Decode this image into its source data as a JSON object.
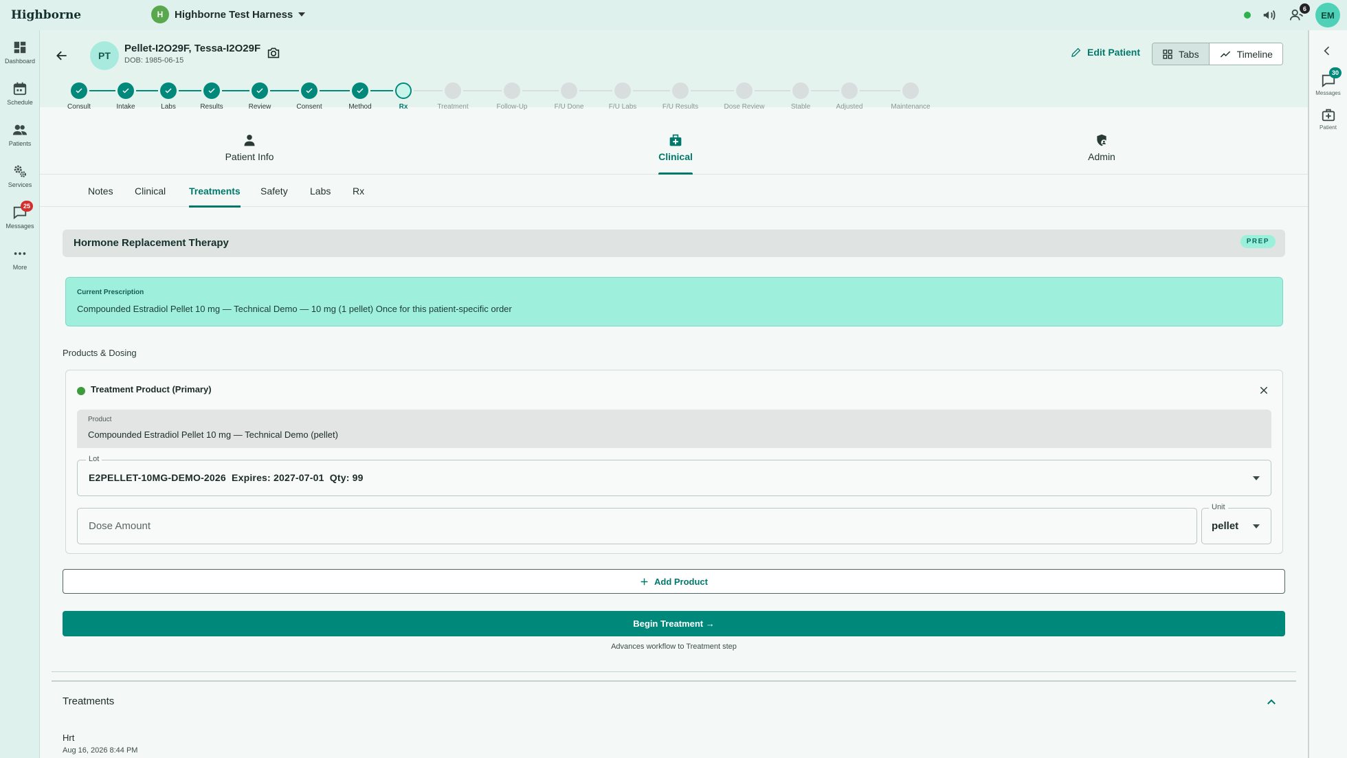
{
  "app": {
    "brand": "Highborne",
    "org_initial": "H",
    "org_name": "Highborne Test Harness"
  },
  "topbar": {
    "team_count": "6",
    "user_initials": "EM",
    "colors": {
      "status": "#2bb24c",
      "accent": "#00897b"
    }
  },
  "leftnav": [
    {
      "label": "Dashboard",
      "icon": "dashboard-icon"
    },
    {
      "label": "Schedule",
      "icon": "calendar-icon"
    },
    {
      "label": "Patients",
      "icon": "people-icon"
    },
    {
      "label": "Services",
      "icon": "gears-icon"
    },
    {
      "label": "Messages",
      "icon": "chat-icon",
      "badge": "25"
    },
    {
      "label": "More",
      "icon": "more-dots-icon"
    }
  ],
  "rightrail": [
    {
      "label": "Messages",
      "icon": "chat-icon",
      "badge": "30"
    },
    {
      "label": "Patient",
      "icon": "medical-card-icon"
    }
  ],
  "patient": {
    "initials": "PT",
    "name": "Pellet-I2O29F, Tessa-I2O29F",
    "dob": "DOB: 1985-06-15"
  },
  "header_actions": {
    "edit": "Edit Patient",
    "tabs": "Tabs",
    "timeline": "Timeline"
  },
  "stepper": {
    "steps": [
      {
        "label": "Consult",
        "state": "done"
      },
      {
        "label": "Intake",
        "state": "done"
      },
      {
        "label": "Labs",
        "state": "done"
      },
      {
        "label": "Results",
        "state": "done"
      },
      {
        "label": "Review",
        "state": "done"
      },
      {
        "label": "Consent",
        "state": "done"
      },
      {
        "label": "Method",
        "state": "done"
      },
      {
        "label": "Rx",
        "state": "current"
      },
      {
        "label": "Treatment",
        "state": "todo"
      },
      {
        "label": "Follow-Up",
        "state": "todo"
      },
      {
        "label": "F/U Done",
        "state": "todo"
      },
      {
        "label": "F/U Labs",
        "state": "todo"
      },
      {
        "label": "F/U Results",
        "state": "todo"
      },
      {
        "label": "Dose Review",
        "state": "todo"
      },
      {
        "label": "Stable",
        "state": "todo"
      },
      {
        "label": "Adjusted",
        "state": "todo"
      },
      {
        "label": "Maintenance",
        "state": "todo"
      }
    ]
  },
  "section_tabs": [
    {
      "label": "Patient Info",
      "icon": "person-icon"
    },
    {
      "label": "Clinical",
      "icon": "medical-kit-icon",
      "active": true
    },
    {
      "label": "Admin",
      "icon": "shield-user-icon"
    }
  ],
  "sub_tabs": [
    {
      "label": "Notes"
    },
    {
      "label": "Clinical"
    },
    {
      "label": "Treatments",
      "active": true
    },
    {
      "label": "Safety"
    },
    {
      "label": "Labs"
    },
    {
      "label": "Rx"
    }
  ],
  "therapy": {
    "title": "Hormone Replacement Therapy",
    "badge": "PREP"
  },
  "prescription": {
    "label": "Current Prescription",
    "text": "Compounded Estradiol Pellet 10 mg — Technical Demo — 10 mg (1 pellet) Once for this patient-specific order"
  },
  "products": {
    "section_title": "Products & Dosing",
    "card_title": "Treatment Product (Primary)",
    "product_label": "Product",
    "product_value": "Compounded Estradiol Pellet 10 mg — Technical Demo (pellet)",
    "lot_label": "Lot",
    "lot_value": "E2PELLET-10MG-DEMO-2026  Expires: 2027-07-01  Qty: 99",
    "dose_placeholder": "Dose Amount",
    "dose_value": "",
    "unit_label": "Unit",
    "unit_value": "pellet"
  },
  "actions": {
    "add_product": "Add Product",
    "begin_treatment": "Begin Treatment →",
    "advance_note": "Advances workflow to Treatment step"
  },
  "treatments": {
    "title": "Treatments",
    "items": [
      {
        "name": "Hrt",
        "date": "Aug 16, 2026 8:44 PM"
      }
    ]
  }
}
